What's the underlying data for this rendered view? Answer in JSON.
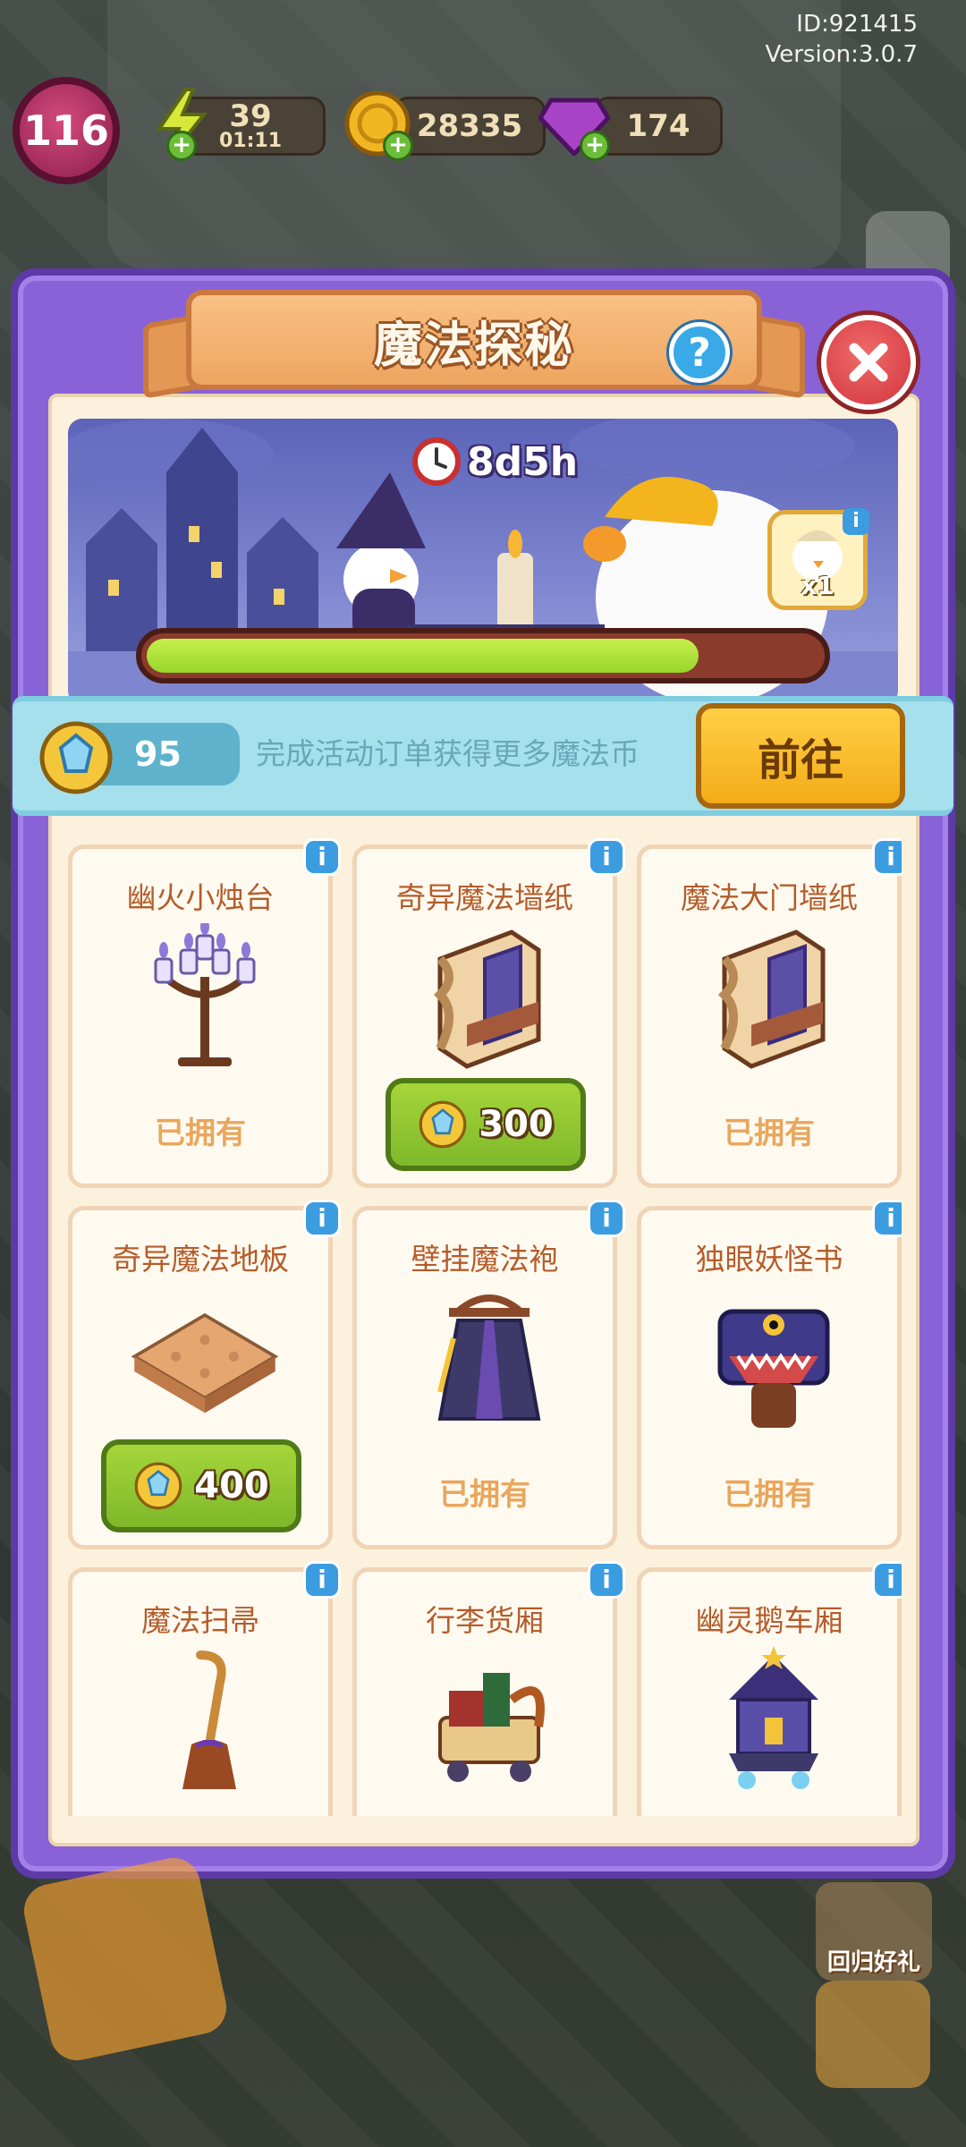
{
  "meta": {
    "id_text": "ID:921415",
    "version_text": "Version:3.0.7"
  },
  "hud": {
    "level": "116",
    "energy": {
      "value": "39",
      "timer": "01:11"
    },
    "coins": "28335",
    "gems": "174"
  },
  "modal": {
    "title": "魔法探秘",
    "help_icon": "question-icon",
    "close_icon": "close-icon"
  },
  "banner": {
    "timer": "8d5h",
    "reward_count": "x1",
    "progress_fraction": 0.82
  },
  "currency": {
    "magic_coins": "95",
    "hint": "完成活动订单获得更多魔法币",
    "go_label": "前往"
  },
  "items": [
    {
      "name": "幽火小烛台",
      "status": "已拥有",
      "price": null,
      "art": "candelabra"
    },
    {
      "name": "奇异魔法墙纸",
      "status": null,
      "price": "300",
      "art": "wallpaper"
    },
    {
      "name": "魔法大门墙纸",
      "status": "已拥有",
      "price": null,
      "art": "wallpaper"
    },
    {
      "name": "奇异魔法地板",
      "status": null,
      "price": "400",
      "art": "floor"
    },
    {
      "name": "壁挂魔法袍",
      "status": "已拥有",
      "price": null,
      "art": "robe"
    },
    {
      "name": "独眼妖怪书",
      "status": "已拥有",
      "price": null,
      "art": "monster-book"
    },
    {
      "name": "魔法扫帚",
      "status": null,
      "price": null,
      "art": "broom"
    },
    {
      "name": "行李货厢",
      "status": null,
      "price": null,
      "art": "luggage-cart"
    },
    {
      "name": "幽灵鹅车厢",
      "status": null,
      "price": null,
      "art": "ghost-cart"
    }
  ],
  "background": {
    "return_gift_label": "回归好礼"
  },
  "colors": {
    "modal_purple": "#8a62d8",
    "panel_cream": "#fbf1dc",
    "accent_orange": "#eea560",
    "buy_green": "#8fc832",
    "go_yellow": "#f7b523",
    "info_blue": "#3c9ce0"
  }
}
